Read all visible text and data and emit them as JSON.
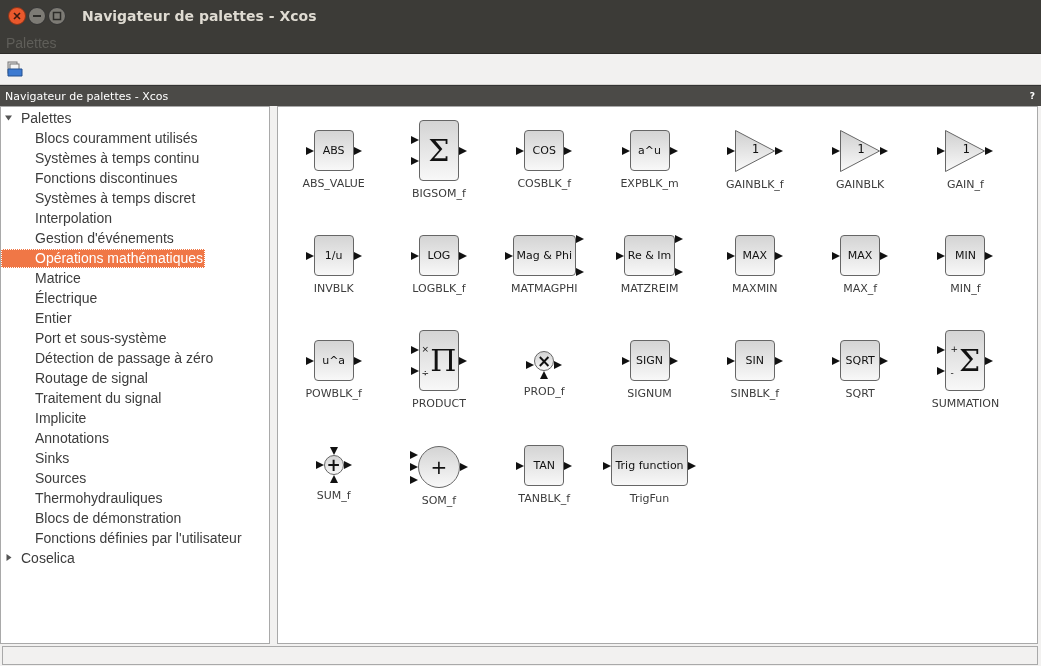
{
  "window": {
    "title": "Navigateur de palettes - Xcos"
  },
  "menu_bar": [
    {
      "label": "Palettes"
    }
  ],
  "dock": {
    "title": "Navigateur de palettes - Xcos",
    "help": "?"
  },
  "tree": [
    {
      "label": "Palettes",
      "expanded": true,
      "selected": false,
      "children": [
        {
          "label": "Blocs couramment utilisés",
          "selected": false
        },
        {
          "label": "Systèmes à temps continu",
          "selected": false
        },
        {
          "label": "Fonctions discontinues",
          "selected": false
        },
        {
          "label": "Systèmes à temps discret",
          "selected": false
        },
        {
          "label": "Interpolation",
          "selected": false
        },
        {
          "label": "Gestion d'événements",
          "selected": false
        },
        {
          "label": "Opérations mathématiques",
          "selected": true
        },
        {
          "label": "Matrice",
          "selected": false
        },
        {
          "label": "Électrique",
          "selected": false
        },
        {
          "label": "Entier",
          "selected": false
        },
        {
          "label": "Port et sous-système",
          "selected": false
        },
        {
          "label": "Détection de passage à zéro",
          "selected": false
        },
        {
          "label": "Routage de signal",
          "selected": false
        },
        {
          "label": "Traitement du signal",
          "selected": false
        },
        {
          "label": "Implicite",
          "selected": false
        },
        {
          "label": "Annotations",
          "selected": false
        },
        {
          "label": "Sinks",
          "selected": false
        },
        {
          "label": "Sources",
          "selected": false
        },
        {
          "label": "Thermohydrauliques",
          "selected": false
        },
        {
          "label": "Blocs de démonstration",
          "selected": false
        },
        {
          "label": "Fonctions définies par l'utilisateur",
          "selected": false
        }
      ]
    },
    {
      "label": "Coselica",
      "expanded": false,
      "selected": false
    }
  ],
  "blocks": [
    {
      "kind": "box",
      "glyph": "ABS",
      "name": "ABS_VALUE"
    },
    {
      "kind": "tall",
      "glyph": "Σ",
      "name": "BIGSOM_f"
    },
    {
      "kind": "box",
      "glyph": "COS",
      "name": "COSBLK_f"
    },
    {
      "kind": "box",
      "glyph": "a^u",
      "name": "EXPBLK_m"
    },
    {
      "kind": "gain",
      "glyph": "1",
      "name": "GAINBLK_f"
    },
    {
      "kind": "gain",
      "glyph": "1",
      "name": "GAINBLK"
    },
    {
      "kind": "gain",
      "glyph": "1",
      "name": "GAIN_f"
    },
    {
      "kind": "box",
      "glyph": "1/u",
      "name": "INVBLK"
    },
    {
      "kind": "box",
      "glyph": "LOG",
      "name": "LOGBLK_f"
    },
    {
      "kind": "split",
      "glyph": "Mag & Phi",
      "name": "MATMAGPHI"
    },
    {
      "kind": "split",
      "glyph": "Re & Im",
      "name": "MATZREIM"
    },
    {
      "kind": "box",
      "glyph": "MAX",
      "name": "MAXMIN"
    },
    {
      "kind": "box",
      "glyph": "MAX",
      "name": "MAX_f"
    },
    {
      "kind": "box",
      "glyph": "MIN",
      "name": "MIN_f"
    },
    {
      "kind": "box",
      "glyph": "u^a",
      "name": "POWBLK_f"
    },
    {
      "kind": "tall",
      "glyph": "Π",
      "port_labels": [
        "×",
        "÷"
      ],
      "name": "PRODUCT"
    },
    {
      "kind": "prod",
      "glyph": "×",
      "name": "PROD_f"
    },
    {
      "kind": "box",
      "glyph": "SIGN",
      "name": "SIGNUM"
    },
    {
      "kind": "box",
      "glyph": "SIN",
      "name": "SINBLK_f"
    },
    {
      "kind": "box",
      "glyph": "SQRT",
      "name": "SQRT"
    },
    {
      "kind": "tall",
      "glyph": "Σ",
      "port_labels": [
        "+",
        "-"
      ],
      "name": "SUMMATION"
    },
    {
      "kind": "sum",
      "glyph": "+",
      "name": "SUM_f"
    },
    {
      "kind": "som",
      "glyph": "+",
      "name": "SOM_f"
    },
    {
      "kind": "box",
      "glyph": "TAN",
      "name": "TANBLK_f"
    },
    {
      "kind": "box",
      "glyph": "Trig function",
      "name": "TrigFun"
    }
  ]
}
